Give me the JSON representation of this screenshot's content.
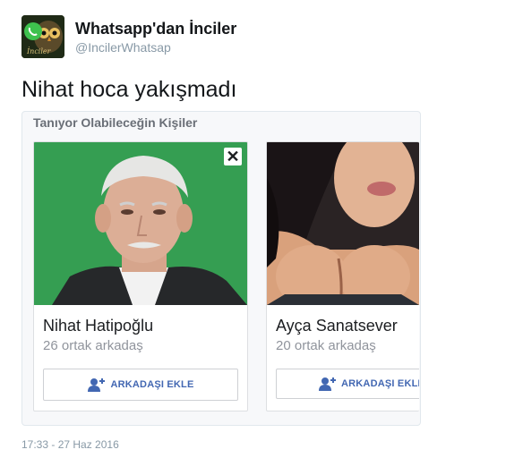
{
  "tweet": {
    "display_name": "Whatsapp'dan İnciler",
    "handle": "@IncilerWhatsap",
    "text": "Nihat hoca yakışmadı",
    "timestamp": "17:33 - 27 Haz 2016",
    "avatar_label": "İnciler"
  },
  "card": {
    "header": "Tanıyor Olabileceğin Kişiler",
    "suggestions": [
      {
        "name": "Nihat Hatipoğlu",
        "mutual": "26 ortak arkadaş",
        "button_label": "ARKADAŞI EKLE",
        "close_glyph": "✕"
      },
      {
        "name": "Ayça Sanatsever",
        "mutual": "20 ortak arkadaş",
        "button_label": "ARKADAŞI EKLE"
      }
    ]
  },
  "colors": {
    "facebook_blue": "#4267b2",
    "photo_green_bg": "#3aa257",
    "twitter_gray": "#8899a6"
  }
}
